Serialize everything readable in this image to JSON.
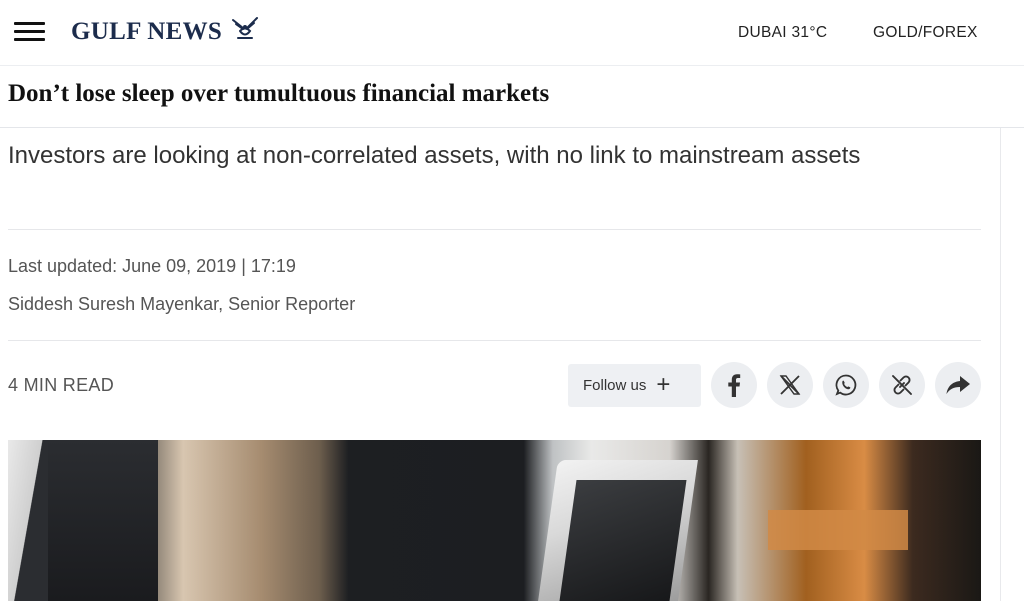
{
  "header": {
    "menu_icon": "hamburger-menu-icon",
    "logo_text": "GULF NEWS",
    "logo_icon": "falcon-emblem-icon",
    "weather": "DUBAI 31°C",
    "gold_forex": "GOLD/FOREX"
  },
  "article": {
    "title": "Don’t lose sleep over tumultuous financial markets",
    "summary": "Investors are looking at non-correlated assets, with no link to mainstream assets",
    "last_updated": "Last updated: June 09, 2019 | 17:19",
    "byline": "Siddesh Suresh Mayenkar, Senior Reporter",
    "read_time": "4 MIN READ"
  },
  "share": {
    "follow_label": "Follow us",
    "follow_icon": "plus-icon",
    "buttons": [
      "facebook-icon",
      "x-icon",
      "whatsapp-icon",
      "link-icon",
      "share-arrow-icon"
    ]
  },
  "colors": {
    "logo_navy": "#1c2c4c",
    "chip_bg": "#eceef1",
    "text_dark": "#111111",
    "text_body": "#333333",
    "text_meta": "#555555"
  }
}
